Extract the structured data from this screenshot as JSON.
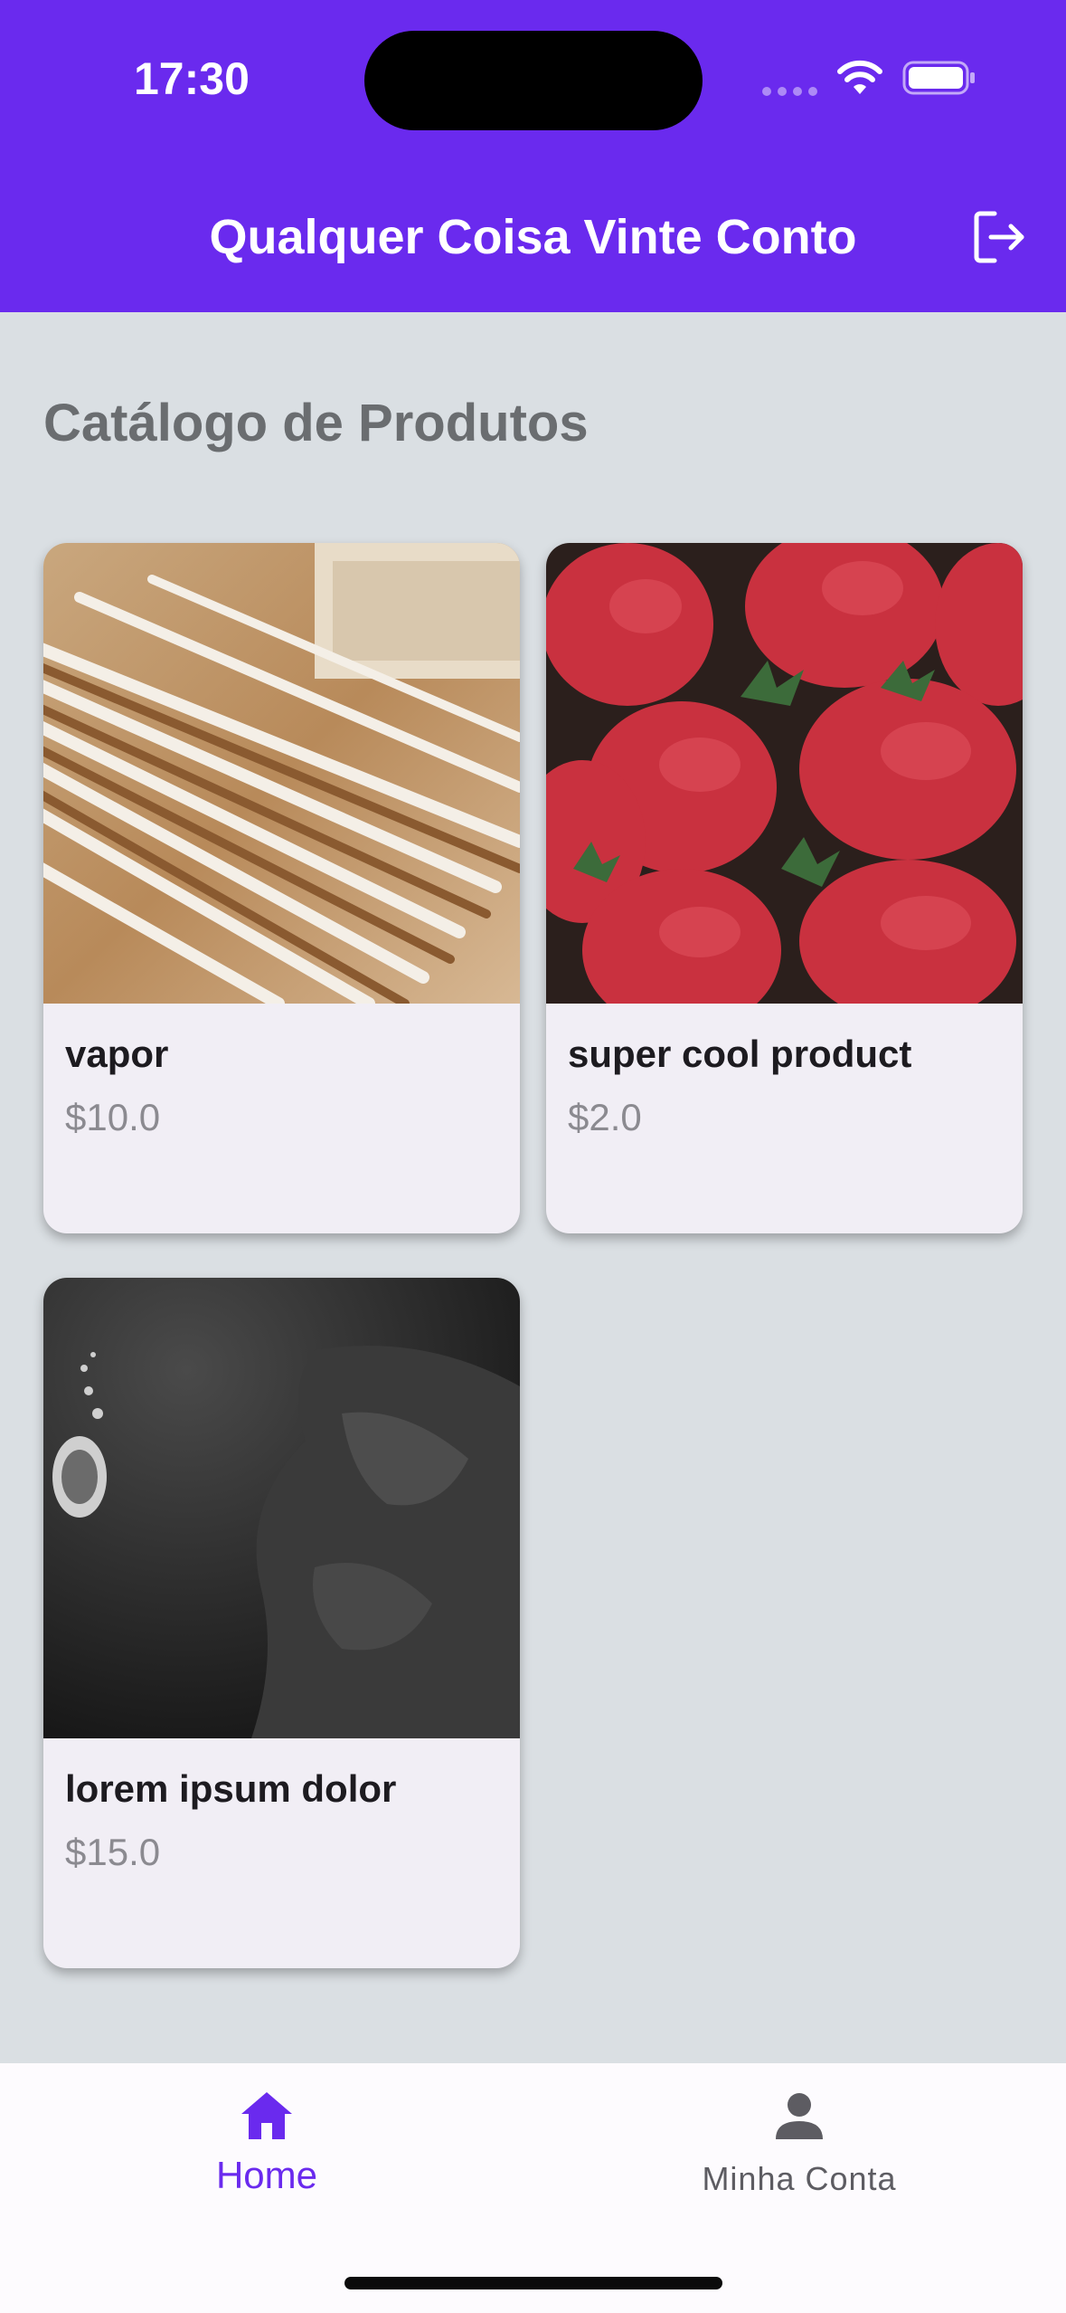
{
  "status_bar": {
    "time": "17:30"
  },
  "header": {
    "title": "Qualquer Coisa Vinte Conto",
    "logout_icon": "logout-icon"
  },
  "page": {
    "section_title": "Catálogo de Produtos"
  },
  "products": [
    {
      "name": "vapor",
      "price": "$10.0",
      "image": "incense-sticks-photo"
    },
    {
      "name": "super cool product",
      "price": "$2.0",
      "image": "strawberries-photo"
    },
    {
      "name": "lorem ipsum dolor",
      "price": "$15.0",
      "image": "scuba-diver-photo"
    }
  ],
  "bottom_nav": {
    "items": [
      {
        "label": "Home",
        "icon": "home-icon",
        "active": true
      },
      {
        "label": "Minha Conta",
        "icon": "person-icon",
        "active": false
      }
    ]
  },
  "colors": {
    "primary": "#6a2aee",
    "background": "#dadfe3",
    "card": "#f1eef5",
    "inactive": "#5d5c62"
  }
}
